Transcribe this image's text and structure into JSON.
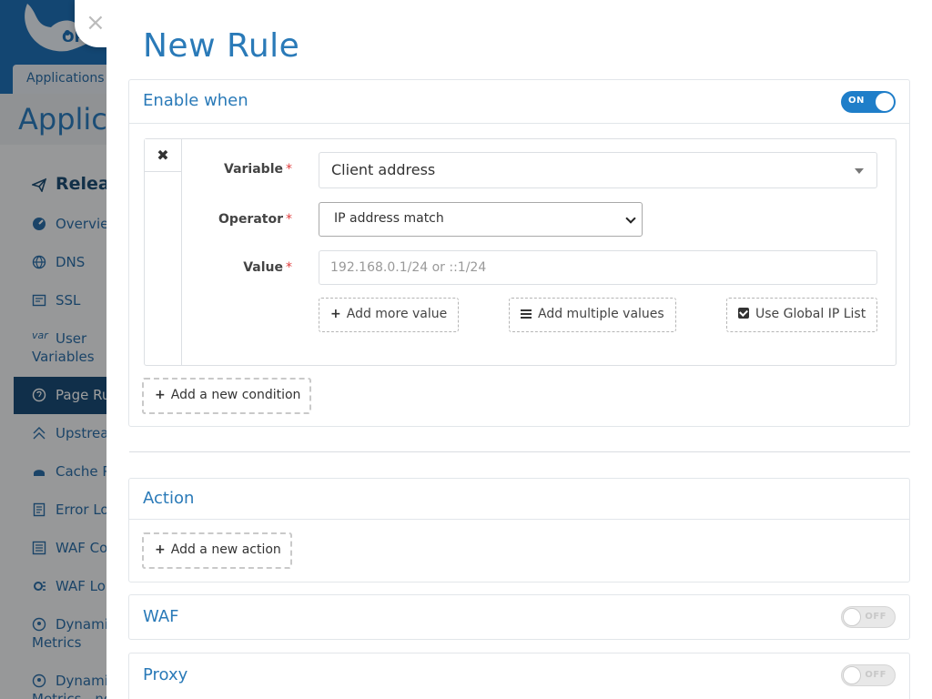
{
  "background": {
    "breadcrumb_tab": "Applications",
    "page_title": "Applica",
    "sidebar": {
      "section": "Release",
      "items": [
        {
          "label": "Overview"
        },
        {
          "label": "DNS"
        },
        {
          "label": "SSL"
        },
        {
          "label": "User",
          "label2": "Variables",
          "icon_text": "var"
        },
        {
          "label": "Page Ru"
        },
        {
          "label": "Upstrea"
        },
        {
          "label": "Cache P"
        },
        {
          "label": "Error Lo"
        },
        {
          "label": "WAF Co"
        },
        {
          "label": "WAF Lo"
        },
        {
          "label": "Dynami",
          "label2": "Metrics"
        },
        {
          "label": "Dynami",
          "label2": "Metrics - no"
        }
      ]
    },
    "close_glyph": "×"
  },
  "drawer": {
    "title": "New Rule",
    "enable_when": {
      "title": "Enable when",
      "toggle_label": "ON",
      "remove_glyph": "✖",
      "variable": {
        "label": "Variable",
        "required_mark": "*",
        "value": "Client address"
      },
      "operator": {
        "label": "Operator",
        "required_mark": "*",
        "value": "IP address match"
      },
      "value": {
        "label": "Value",
        "required_mark": "*",
        "placeholder": "192.168.0.1/24 or ::1/24"
      },
      "buttons": {
        "add_more_value": "Add more value",
        "add_multiple_values": "Add multiple values",
        "use_global_ip_list": "Use Global IP List"
      },
      "add_condition": "Add a new condition"
    },
    "action": {
      "title": "Action",
      "add_action": "Add a new action"
    },
    "waf": {
      "title": "WAF",
      "toggle_label": "OFF"
    },
    "proxy": {
      "title": "Proxy",
      "toggle_label": "OFF"
    }
  },
  "colors": {
    "accent": "#2a7ab8",
    "toggle_on": "#1f7ec9",
    "required": "#e03c3c",
    "header_blue": "#1f72b8"
  }
}
